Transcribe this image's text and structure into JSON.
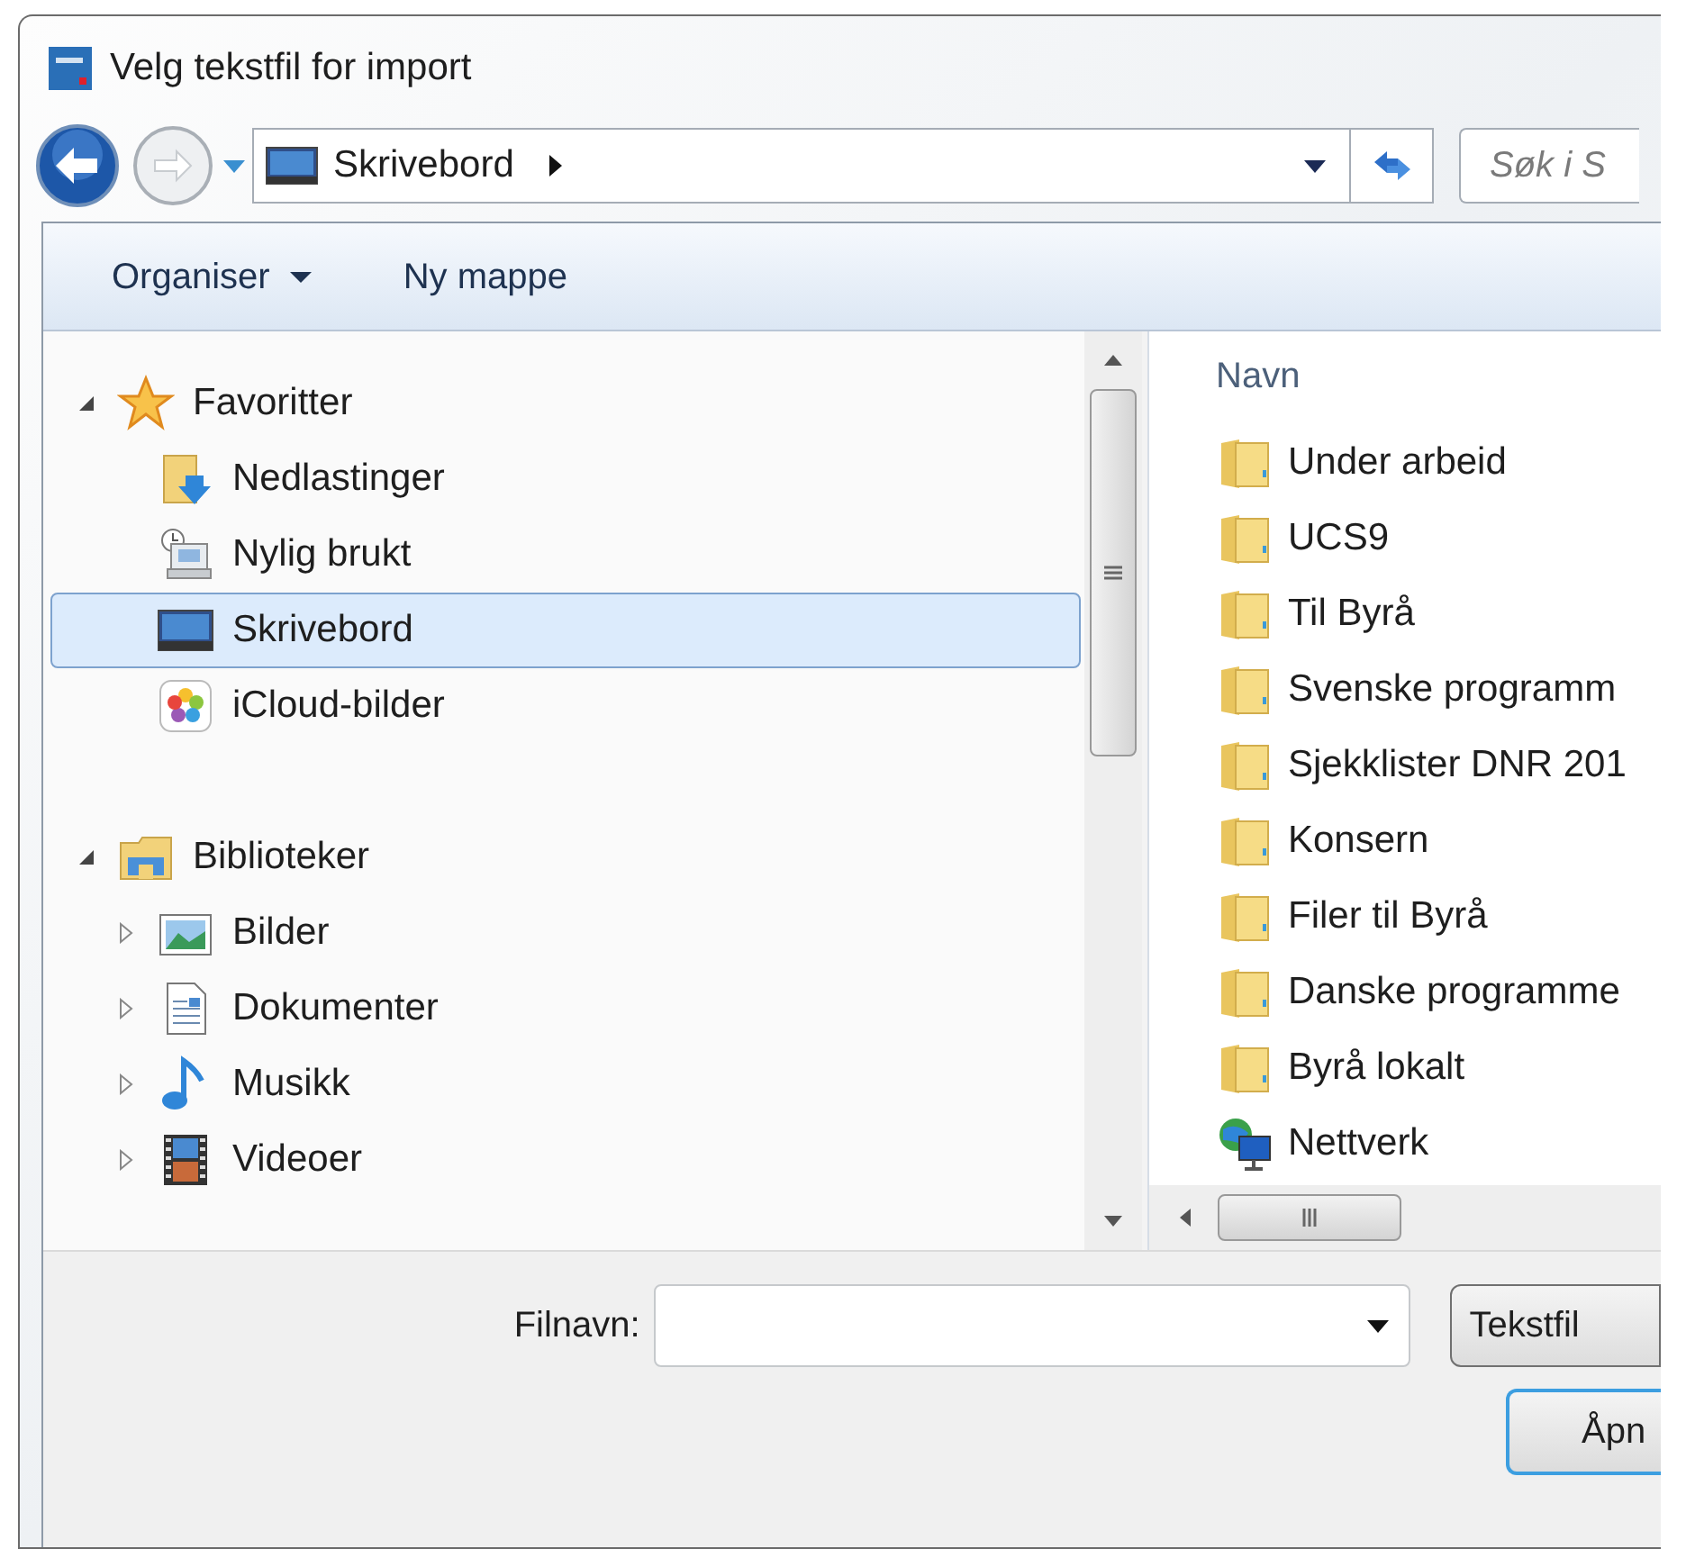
{
  "window": {
    "title": "Velg tekstfil for import"
  },
  "address_bar": {
    "path": "Skrivebord"
  },
  "search": {
    "placeholder": "Søk i S"
  },
  "toolbar": [
    {
      "label": "Organiser",
      "kind": "menu"
    },
    {
      "label": "Ny mappe",
      "kind": "button"
    }
  ],
  "nav_tree": [
    {
      "label": "Favoritter",
      "kind": "favorites",
      "expanded": true,
      "selected": false,
      "children": [
        {
          "label": "Nedlastinger",
          "kind": "downloads",
          "selected": false
        },
        {
          "label": "Nylig brukt",
          "kind": "recent",
          "selected": false
        },
        {
          "label": "Skrivebord",
          "kind": "desktop",
          "selected": true
        },
        {
          "label": "iCloud-bilder",
          "kind": "photos",
          "selected": false
        }
      ]
    },
    {
      "label": "Biblioteker",
      "kind": "libraries",
      "expanded": true,
      "selected": false,
      "children": [
        {
          "label": "Bilder",
          "kind": "pictures",
          "expanded": false,
          "selected": false
        },
        {
          "label": "Dokumenter",
          "kind": "documents",
          "expanded": false,
          "selected": false
        },
        {
          "label": "Musikk",
          "kind": "music",
          "expanded": false,
          "selected": false
        },
        {
          "label": "Videoer",
          "kind": "videos",
          "expanded": false,
          "selected": false
        }
      ]
    }
  ],
  "file_list": {
    "columns": [
      "Navn"
    ],
    "items": [
      {
        "name": "Under arbeid",
        "kind": "folder"
      },
      {
        "name": "UCS9",
        "kind": "folder"
      },
      {
        "name": "Til Byrå",
        "kind": "folder"
      },
      {
        "name": "Svenske programm",
        "kind": "folder"
      },
      {
        "name": "Sjekklister DNR 201",
        "kind": "folder"
      },
      {
        "name": "Konsern",
        "kind": "folder"
      },
      {
        "name": "Filer til Byrå",
        "kind": "folder"
      },
      {
        "name": "Danske programme",
        "kind": "folder"
      },
      {
        "name": "Byrå lokalt",
        "kind": "folder"
      },
      {
        "name": "Nettverk",
        "kind": "network"
      }
    ]
  },
  "file_name": {
    "label": "Filnavn:"
  },
  "file_type": {
    "value": "Tekstfil"
  },
  "buttons": [
    "Åpn"
  ]
}
